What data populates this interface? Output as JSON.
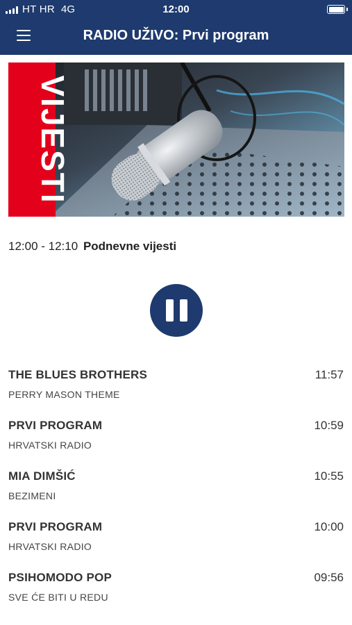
{
  "status_bar": {
    "carrier": "HT HR",
    "network": "4G",
    "time": "12:00",
    "battery_level": 1.0
  },
  "header": {
    "title": "RADIO UŽIVO: Prvi program",
    "menu_icon": "hamburger-menu-icon",
    "background_color": "#1e3a6e"
  },
  "banner": {
    "label": "VIJESTI",
    "label_color": "#e3001b"
  },
  "now_playing": {
    "time_range": "12:00 - 12:10",
    "title": "Podnevne vijesti"
  },
  "player": {
    "state_icon": "pause-icon",
    "accent_color": "#1e3a6e"
  },
  "tracks": [
    {
      "artist": "THE BLUES BROTHERS",
      "title": "PERRY MASON THEME",
      "time": "11:57"
    },
    {
      "artist": "PRVI PROGRAM",
      "title": "HRVATSKI RADIO",
      "time": "10:59"
    },
    {
      "artist": "MIA DIMŠIĆ",
      "title": "BEZIMENI",
      "time": "10:55"
    },
    {
      "artist": "PRVI PROGRAM",
      "title": "HRVATSKI RADIO",
      "time": "10:00"
    },
    {
      "artist": "PSIHOMODO POP",
      "title": "SVE ĆE BITI U REDU",
      "time": "09:56"
    }
  ]
}
